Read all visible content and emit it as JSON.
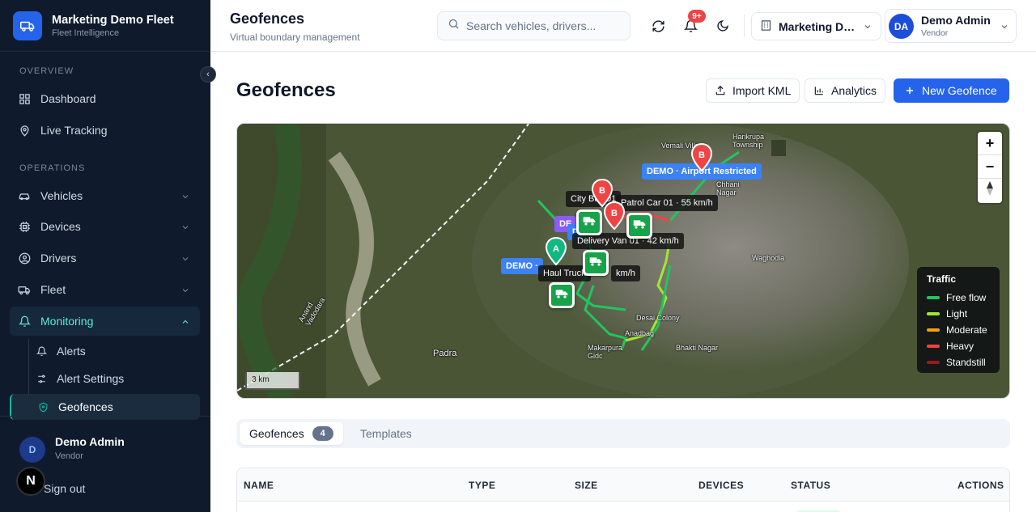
{
  "brand": {
    "name": "Marketing Demo Fleet",
    "subtitle": "Fleet Intelligence"
  },
  "sidebar": {
    "sections": {
      "overview": "OVERVIEW",
      "operations": "OPERATIONS"
    },
    "items": [
      {
        "label": "Dashboard",
        "icon": "dashboard-icon"
      },
      {
        "label": "Live Tracking",
        "icon": "map-pin-icon"
      },
      {
        "label": "Vehicles",
        "icon": "car-icon"
      },
      {
        "label": "Devices",
        "icon": "chip-icon"
      },
      {
        "label": "Drivers",
        "icon": "user-circle-icon"
      },
      {
        "label": "Fleet",
        "icon": "truck-icon"
      },
      {
        "label": "Monitoring",
        "icon": "bell-icon"
      }
    ],
    "monitoring_sub": [
      {
        "label": "Alerts",
        "icon": "bell-icon"
      },
      {
        "label": "Alert Settings",
        "icon": "sliders-icon"
      },
      {
        "label": "Geofences",
        "icon": "shield-icon"
      }
    ],
    "user": {
      "initial": "D",
      "name": "Demo Admin",
      "role": "Vendor"
    },
    "signout": "Sign out",
    "floating_badge": "N"
  },
  "header": {
    "title": "Geofences",
    "subtitle": "Virtual boundary management",
    "search_placeholder": "Search vehicles, drivers...",
    "notifications_badge": "9+",
    "org": "Marketing Demo Fleet",
    "user": {
      "initials": "DA",
      "name": "Demo Admin",
      "role": "Vendor"
    }
  },
  "main": {
    "title": "Geofences",
    "buttons": {
      "import": "Import KML",
      "analytics": "Analytics",
      "new": "New Geofence"
    }
  },
  "map": {
    "places": [
      "Vemali Village",
      "Harikrupa Township",
      "Chhani Nagar",
      "Waghodia",
      "Padra",
      "Desai Colony",
      "Anadbag",
      "Makarpura Gidc",
      "Bhakti Nagar",
      "Anand Vadodara"
    ],
    "geofence_labels": [
      "DEMO · Airport Restricted",
      "DEMO · "
    ],
    "vehicle_labels": [
      "City Bus 01",
      "Patrol Car 01 · 55 km/h",
      "Delivery Van 01 · 42 km/h",
      "Haul Truck",
      "km/h"
    ],
    "pins": [
      "A",
      "B",
      "B",
      "B"
    ],
    "small_tags": [
      "DE",
      "D"
    ],
    "scale": "3 km",
    "zoom": {
      "in": "+",
      "out": "−"
    },
    "traffic_legend": {
      "title": "Traffic",
      "items": [
        {
          "label": "Free flow",
          "color": "#22c55e"
        },
        {
          "label": "Light",
          "color": "#a3e635"
        },
        {
          "label": "Moderate",
          "color": "#f59e0b"
        },
        {
          "label": "Heavy",
          "color": "#ef4444"
        },
        {
          "label": "Standstill",
          "color": "#991b1b"
        }
      ]
    }
  },
  "tabs": [
    {
      "label": "Geofences",
      "count": "4"
    },
    {
      "label": "Templates"
    }
  ],
  "table": {
    "columns": [
      "NAME",
      "TYPE",
      "SIZE",
      "DEVICES",
      "STATUS",
      "ACTIONS"
    ]
  }
}
